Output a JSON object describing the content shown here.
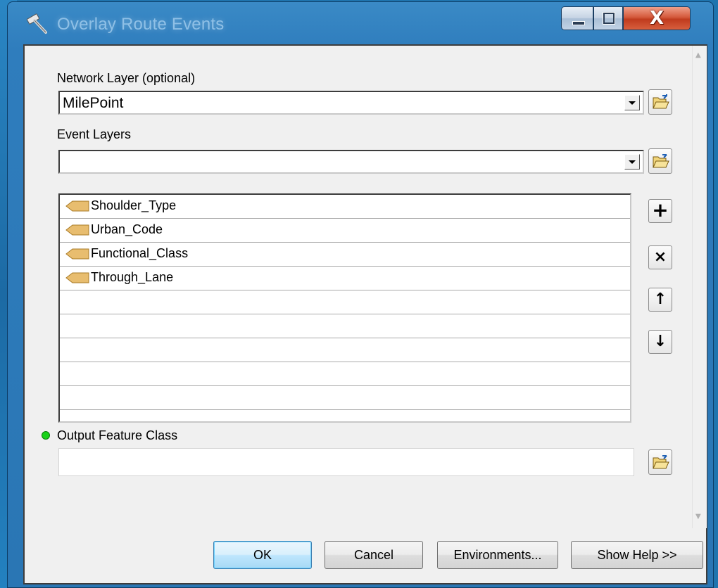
{
  "window": {
    "title": "Overlay Route Events",
    "close_glyph": "X"
  },
  "form": {
    "network_layer_label": "Network Layer (optional)",
    "network_layer_value": "MilePoint",
    "event_layers_label": "Event Layers",
    "event_layers_value": "",
    "event_list": [
      {
        "label": "Shoulder_Type",
        "icon": "event-layer-icon"
      },
      {
        "label": "Urban_Code",
        "icon": "event-layer-icon"
      },
      {
        "label": "Functional_Class",
        "icon": "event-layer-icon"
      },
      {
        "label": "Through_Lane",
        "icon": "event-layer-icon"
      }
    ],
    "output_label": "Output Feature Class",
    "output_value": "",
    "list_buttons": {
      "add": "+",
      "remove": "×",
      "up": "↑",
      "down": "↓"
    }
  },
  "buttons": {
    "ok": "OK",
    "cancel": "Cancel",
    "environments": "Environments...",
    "show_help": "Show Help >>"
  },
  "colors": {
    "required_indicator": "#18d218",
    "desktop": "#1f74ae",
    "event_icon": "#e8bd6f"
  }
}
